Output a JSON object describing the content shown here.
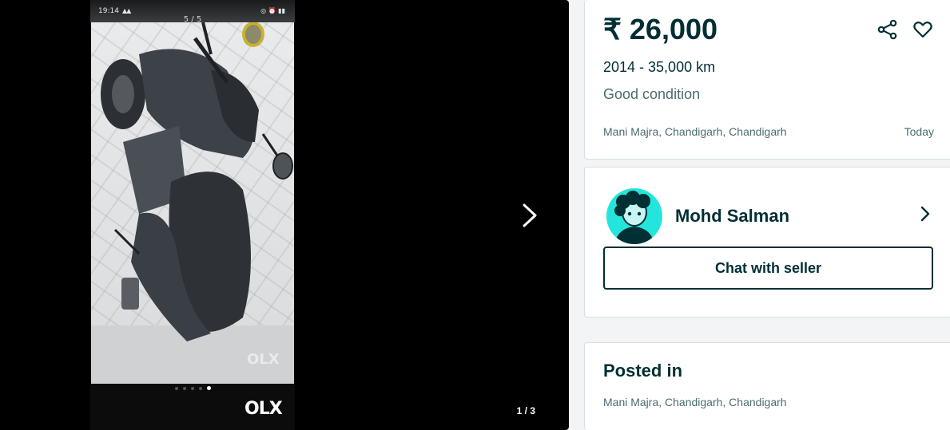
{
  "gallery": {
    "phone_screenshot": {
      "time": "19:14",
      "signal_text": "³ᴱ ≡ ≡",
      "counter": "5 / 5",
      "total_dots": 5,
      "active_dot": 5
    },
    "watermark": "OLX",
    "logo": "OLX",
    "counter": "1 / 3"
  },
  "ad": {
    "price": "₹ 26,000",
    "subtitle": "2014 - 35,000 km",
    "title": "Good condition",
    "location": "Mani Majra, Chandigarh, Chandigarh",
    "date": "Today"
  },
  "seller": {
    "name": "Mohd Salman",
    "chat_label": "Chat with seller"
  },
  "posted": {
    "heading": "Posted in",
    "location": "Mani Majra, Chandigarh, Chandigarh"
  },
  "colors": {
    "brand_dark": "#002f34",
    "avatar_bg": "#23e5db",
    "gallery_bg": "#000000"
  },
  "icons": [
    "share-icon",
    "heart-icon",
    "chevron-right-icon",
    "next-arrow-icon",
    "back-arrow-icon"
  ]
}
